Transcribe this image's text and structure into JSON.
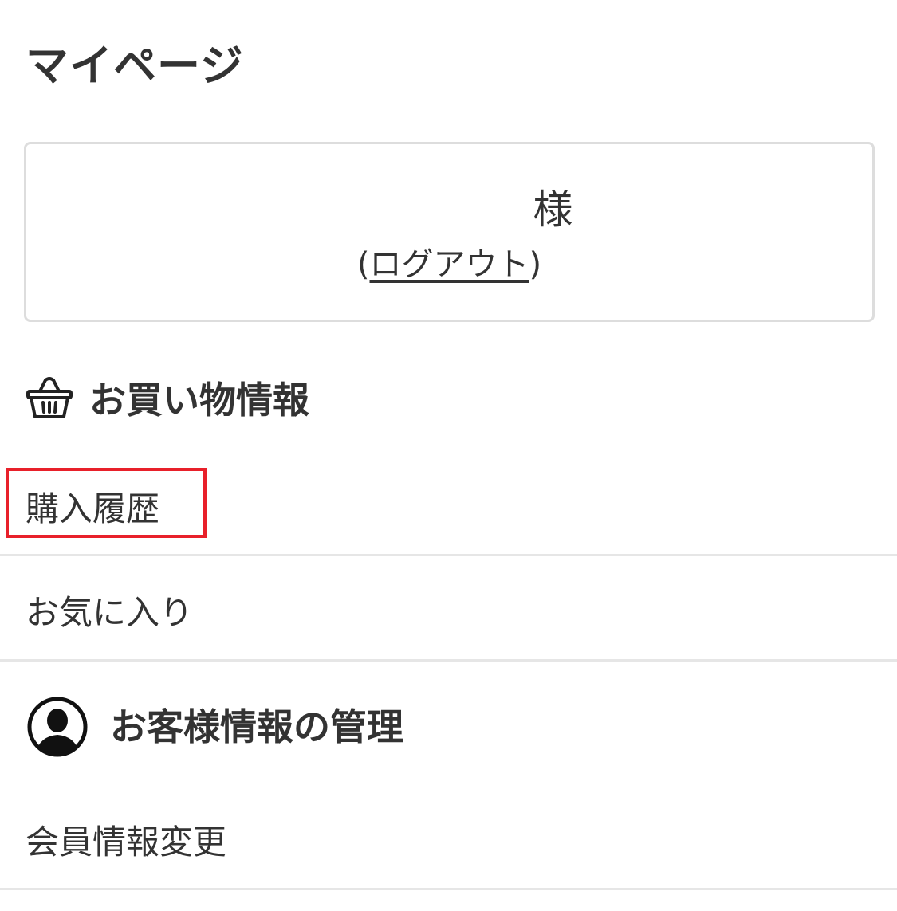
{
  "header": {
    "title": "マイページ"
  },
  "user_box": {
    "name": "",
    "honorific": "様",
    "logout_open": "(",
    "logout_label": "ログアウト",
    "logout_close": ")"
  },
  "shopping": {
    "heading": "お買い物情報",
    "icon": "basket-icon",
    "items": [
      {
        "label": "購入履歴"
      },
      {
        "label": "お気に入り"
      }
    ]
  },
  "customer": {
    "heading": "お客様情報の管理",
    "icon": "user-avatar-icon",
    "items": [
      {
        "label": "会員情報変更"
      }
    ]
  },
  "colors": {
    "text": "#333333",
    "border": "#dddddd",
    "divider": "#e6e6e6",
    "highlight": "#e8202a"
  }
}
